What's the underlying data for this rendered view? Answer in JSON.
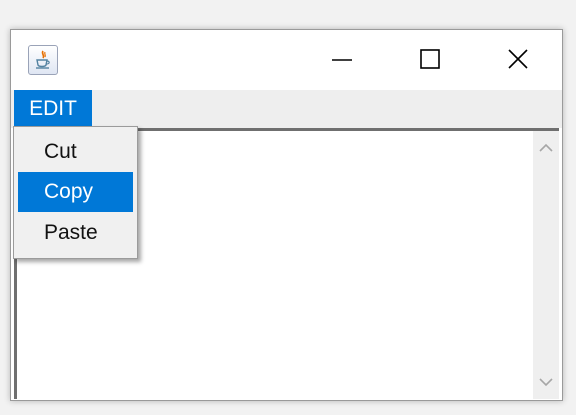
{
  "window": {
    "icon": "java-coffee-icon",
    "controls": [
      "minimize-icon",
      "maximize-icon",
      "close-icon"
    ]
  },
  "menubar": {
    "items": [
      {
        "label": "EDIT",
        "active": true
      }
    ]
  },
  "popup_menu": {
    "items": [
      {
        "label": "Cut",
        "selected": false
      },
      {
        "label": "Copy",
        "selected": true
      },
      {
        "label": "Paste",
        "selected": false
      }
    ]
  },
  "text_area": {
    "value": ""
  },
  "colors": {
    "accent": "#0078d7",
    "menubar_bg": "#eeeeee",
    "popup_bg": "#f0f0f0"
  }
}
